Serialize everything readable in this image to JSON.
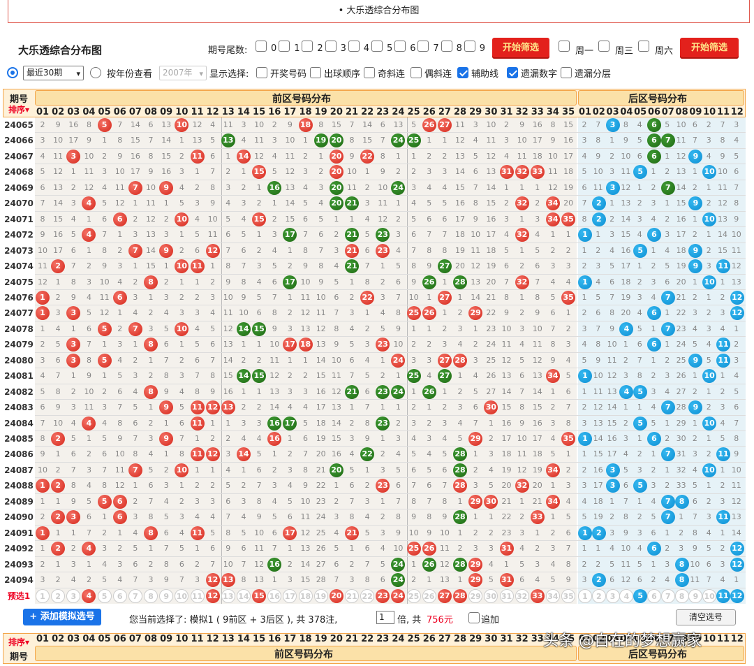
{
  "page": {
    "top_title": "• 大乐透综合分布图"
  },
  "toolbar": {
    "title": "大乐透综合分布图",
    "tail_label": "期号尾数:",
    "tail_digits": [
      "0",
      "1",
      "2",
      "3",
      "4",
      "5",
      "6",
      "7",
      "8",
      "9"
    ],
    "filter_label": "开始筛选",
    "weekdays": [
      "周一",
      "周三",
      "周六"
    ],
    "filter_label2": "开始筛选"
  },
  "options": {
    "period_select": "最近30期",
    "year_label": "按年份查看",
    "year_select": "2007年",
    "display_label": "显示选择:",
    "checks": [
      {
        "label": "开奖号码",
        "checked": false
      },
      {
        "label": "出球顺序",
        "checked": false
      },
      {
        "label": "奇斜连",
        "checked": false
      },
      {
        "label": "偶斜连",
        "checked": false
      },
      {
        "label": "辅助线",
        "checked": true
      },
      {
        "label": "遗漏数字",
        "checked": true
      },
      {
        "label": "遗漏分层",
        "checked": false
      }
    ]
  },
  "header": {
    "period": "期号",
    "sort": "排序",
    "front_title": "前区号码分布",
    "back_title": "后区号码分布",
    "front_nums": [
      "01",
      "02",
      "03",
      "04",
      "05",
      "06",
      "07",
      "08",
      "09",
      "10",
      "11",
      "12",
      "13",
      "14",
      "15",
      "16",
      "17",
      "18",
      "19",
      "20",
      "21",
      "22",
      "23",
      "24",
      "25",
      "26",
      "27",
      "28",
      "29",
      "30",
      "31",
      "32",
      "33",
      "34",
      "35"
    ],
    "back_nums": [
      "01",
      "02",
      "03",
      "04",
      "05",
      "06",
      "07",
      "08",
      "09",
      "10",
      "11",
      "12"
    ]
  },
  "rows": [
    {
      "period": "24065",
      "front": [
        5,
        10,
        18,
        26,
        27
      ],
      "back": [
        3,
        6
      ]
    },
    {
      "period": "24066",
      "front": [
        13,
        19,
        20,
        24,
        25
      ],
      "back": [
        6,
        7
      ]
    },
    {
      "period": "24067",
      "front": [
        3,
        11,
        14,
        20,
        22
      ],
      "back": [
        6,
        9
      ]
    },
    {
      "period": "24068",
      "front": [
        15,
        20,
        31,
        32,
        33
      ],
      "back": [
        5,
        10
      ]
    },
    {
      "period": "24069",
      "front": [
        7,
        9,
        16,
        20,
        24
      ],
      "back": [
        3,
        7
      ]
    },
    {
      "period": "24070",
      "front": [
        4,
        20,
        21,
        32,
        34
      ],
      "back": [
        2,
        9
      ]
    },
    {
      "period": "24071",
      "front": [
        6,
        10,
        15,
        34,
        35
      ],
      "back": [
        2,
        10
      ]
    },
    {
      "period": "24072",
      "front": [
        4,
        17,
        21,
        23,
        32
      ],
      "back": [
        1,
        6
      ]
    },
    {
      "period": "24073",
      "front": [
        7,
        9,
        12,
        21,
        23
      ],
      "back": [
        5,
        9
      ]
    },
    {
      "period": "24074",
      "front": [
        2,
        10,
        11,
        21,
        27
      ],
      "back": [
        9,
        11
      ]
    },
    {
      "period": "24075",
      "front": [
        8,
        17,
        26,
        28,
        32
      ],
      "back": [
        1,
        10
      ]
    },
    {
      "period": "24076",
      "front": [
        1,
        6,
        22,
        27,
        35
      ],
      "back": [
        7,
        12
      ]
    },
    {
      "period": "24077",
      "front": [
        1,
        3,
        25,
        26,
        29
      ],
      "back": [
        6,
        12
      ]
    },
    {
      "period": "24078",
      "front": [
        5,
        7,
        10,
        14,
        15
      ],
      "back": [
        4,
        7
      ]
    },
    {
      "period": "24079",
      "front": [
        3,
        8,
        17,
        18,
        23
      ],
      "back": [
        6,
        11
      ]
    },
    {
      "period": "24080",
      "front": [
        3,
        5,
        24,
        27,
        28
      ],
      "back": [
        9,
        11
      ]
    },
    {
      "period": "24081",
      "front": [
        14,
        15,
        25,
        27,
        34
      ],
      "back": [
        1,
        10
      ]
    },
    {
      "period": "24082",
      "front": [
        8,
        21,
        23,
        24,
        26
      ],
      "back": [
        4,
        5
      ]
    },
    {
      "period": "24083",
      "front": [
        9,
        11,
        12,
        13,
        30
      ],
      "back": [
        7,
        9
      ]
    },
    {
      "period": "24084",
      "front": [
        4,
        11,
        16,
        17,
        23
      ],
      "back": [
        5,
        10
      ]
    },
    {
      "period": "24085",
      "front": [
        2,
        9,
        16,
        29,
        35
      ],
      "back": [
        1,
        6
      ]
    },
    {
      "period": "24086",
      "front": [
        11,
        12,
        14,
        22,
        28
      ],
      "back": [
        7,
        11
      ]
    },
    {
      "period": "24087",
      "front": [
        7,
        10,
        20,
        28,
        34
      ],
      "back": [
        3,
        10
      ]
    },
    {
      "period": "24088",
      "front": [
        1,
        2,
        23,
        28,
        32
      ],
      "back": [
        3,
        5
      ]
    },
    {
      "period": "24089",
      "front": [
        5,
        6,
        29,
        30,
        34
      ],
      "back": [
        7,
        8
      ]
    },
    {
      "period": "24090",
      "front": [
        2,
        3,
        6,
        28,
        33
      ],
      "back": [
        7,
        11
      ]
    },
    {
      "period": "24091",
      "front": [
        1,
        8,
        11,
        17,
        21
      ],
      "back": [
        1,
        2
      ]
    },
    {
      "period": "24092",
      "front": [
        2,
        4,
        25,
        26,
        31
      ],
      "back": [
        6,
        12
      ]
    },
    {
      "period": "24093",
      "front": [
        16,
        24,
        26,
        28,
        29
      ],
      "back": [
        8,
        12
      ]
    },
    {
      "period": "24094",
      "front": [
        12,
        13,
        24,
        29,
        31
      ],
      "back": [
        2,
        8
      ]
    }
  ],
  "preselect": {
    "label": "预选1",
    "front": [
      4,
      12,
      15,
      20,
      23,
      24,
      27,
      28,
      33
    ],
    "back": [
      5,
      11,
      12
    ]
  },
  "bottom": {
    "add_button": "+ 添加模拟选号",
    "current": "您当前选择了: 模拟1 ( 9前区 + 3后区 ), 共 378注,",
    "multiple": "1",
    "mult_label": "倍, 共",
    "amount": "756元",
    "append_label": "追加",
    "clear_button": "清空选号"
  },
  "watermark": "头条 @自在的梦想赢家"
}
